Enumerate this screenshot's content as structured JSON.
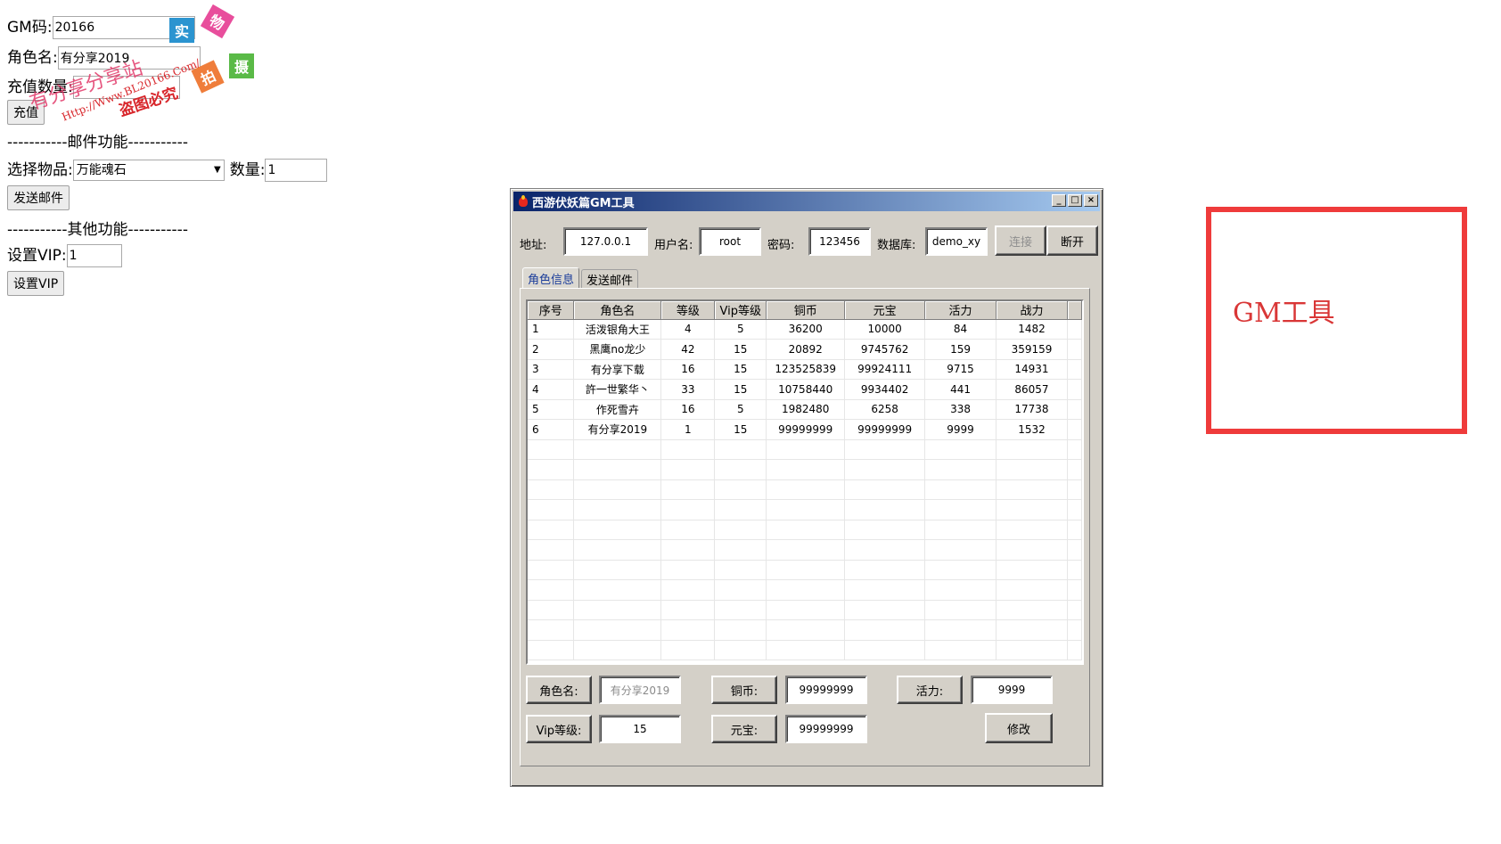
{
  "form": {
    "gm_code_label": "GM码:",
    "gm_code_value": "20166",
    "role_name_label": "角色名:",
    "role_name_value": "有分享2019",
    "recharge_amount_label": "充值数量:",
    "recharge_button": "充值",
    "mail_section_divider": "-----------邮件功能-----------",
    "select_item_label": "选择物品:",
    "select_item_value": "万能魂石",
    "quantity_label": "数量:",
    "quantity_value": "1",
    "send_mail_button": "发送邮件",
    "other_section_divider": "-----------其他功能-----------",
    "set_vip_label": "设置VIP:",
    "set_vip_value": "1",
    "set_vip_button": "设置VIP"
  },
  "watermark": {
    "badge1": "实",
    "badge2": "物",
    "badge3": "拍",
    "badge4": "摄",
    "line1": "有分享分享站",
    "line2": "Http://Www.BL20166.Com/",
    "line3": "盗图必究",
    "colors": {
      "blue": "#2b94d0",
      "pink": "#e84e9c",
      "orange": "#ef7d3b",
      "green": "#5aba47",
      "red": "#d8262b"
    }
  },
  "window": {
    "title": "西游伏妖篇GM工具",
    "minimize": "_",
    "maximize": "□",
    "close": "×",
    "address_label": "地址:",
    "address_value": "127.0.0.1",
    "username_label": "用户名:",
    "username_value": "root",
    "password_label": "密码:",
    "password_value": "123456",
    "database_label": "数据库:",
    "database_value": "demo_xy",
    "connect_button": "连接",
    "disconnect_button": "断开",
    "tabs": [
      "角色信息",
      "发送邮件"
    ],
    "table": {
      "headers": [
        "序号",
        "角色名",
        "等级",
        "Vip等级",
        "铜币",
        "元宝",
        "活力",
        "战力"
      ],
      "rows": [
        [
          "1",
          "活泼银角大王",
          "4",
          "5",
          "36200",
          "10000",
          "84",
          "1482"
        ],
        [
          "2",
          "黑鹰no龙少",
          "42",
          "15",
          "20892",
          "9745762",
          "159",
          "359159"
        ],
        [
          "3",
          "有分享下载",
          "16",
          "15",
          "123525839",
          "99924111",
          "9715",
          "14931"
        ],
        [
          "4",
          "許一世繁华丶",
          "33",
          "15",
          "10758440",
          "9934402",
          "441",
          "86057"
        ],
        [
          "5",
          "作死雪卉",
          "16",
          "5",
          "1982480",
          "6258",
          "338",
          "17738"
        ],
        [
          "6",
          "有分享2019",
          "1",
          "15",
          "99999999",
          "99999999",
          "9999",
          "1532"
        ]
      ]
    },
    "edit": {
      "role_name_label": "角色名:",
      "role_name_value": "有分享2019",
      "copper_label": "铜币:",
      "copper_value": "99999999",
      "vigor_label": "活力:",
      "vigor_value": "9999",
      "vip_label": "Vip等级:",
      "vip_value": "15",
      "ingot_label": "元宝:",
      "ingot_value": "99999999",
      "modify_button": "修改"
    }
  },
  "annotation": {
    "label": "GM工具",
    "border_color": "#ef3b3b"
  }
}
